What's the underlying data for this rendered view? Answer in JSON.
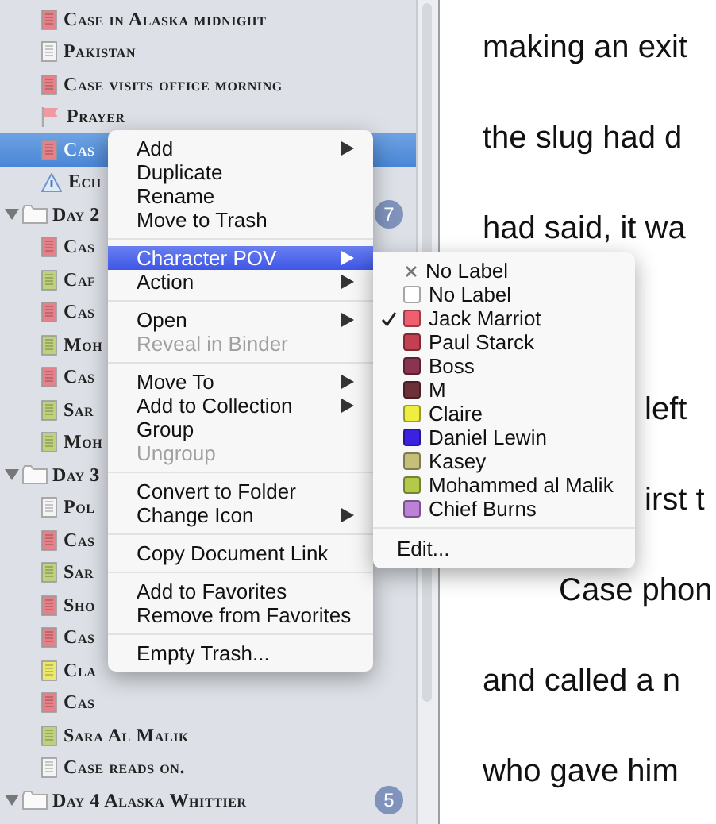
{
  "binder": {
    "leading_children": [
      {
        "kind": "doc",
        "color": "#e8808a",
        "label": "Case in Alaska midnight",
        "selected": false
      },
      {
        "kind": "doc",
        "color": "#f4f4f4",
        "label": "Pakistan",
        "selected": false
      },
      {
        "kind": "doc",
        "color": "#e8808a",
        "label": "Case visits office morning",
        "selected": false
      },
      {
        "kind": "flag",
        "label": "Prayer",
        "selected": false
      },
      {
        "kind": "doc",
        "color": "#e8808a",
        "label": "Cas",
        "selected": true
      },
      {
        "kind": "info",
        "label": "Ech",
        "selected": false
      }
    ],
    "folders": [
      {
        "label": "Day 2",
        "expanded": true,
        "badge": "7",
        "children": [
          {
            "kind": "doc",
            "color": "#e8808a",
            "label": "Cas",
            "selected": false
          },
          {
            "kind": "doc",
            "color": "#bdd27a",
            "label": "Caf",
            "selected": false
          },
          {
            "kind": "doc",
            "color": "#e8808a",
            "label": "Cas",
            "selected": false
          },
          {
            "kind": "doc",
            "color": "#bdd27a",
            "label": "Moh",
            "selected": false
          },
          {
            "kind": "doc",
            "color": "#e8808a",
            "label": "Cas",
            "selected": false
          },
          {
            "kind": "doc",
            "color": "#bdd27a",
            "label": "Sar",
            "selected": false
          },
          {
            "kind": "doc",
            "color": "#bdd27a",
            "label": "Moh",
            "selected": false
          }
        ]
      },
      {
        "label": "Day 3",
        "expanded": true,
        "children": [
          {
            "kind": "doc",
            "color": "#f4f4f4",
            "label": "Pol",
            "selected": false
          },
          {
            "kind": "doc",
            "color": "#e8808a",
            "label": "Cas",
            "selected": false
          },
          {
            "kind": "doc",
            "color": "#bdd27a",
            "label": "Sar",
            "selected": false
          },
          {
            "kind": "doc",
            "color": "#e8808a",
            "label": "Sho",
            "selected": false
          },
          {
            "kind": "doc",
            "color": "#e8808a",
            "label": "Cas",
            "selected": false
          },
          {
            "kind": "doc",
            "color": "#ece96a",
            "label": "Cla",
            "selected": false
          },
          {
            "kind": "doc",
            "color": "#e8808a",
            "label": "Cas",
            "selected": false
          },
          {
            "kind": "doc",
            "color": "#bdd27a",
            "label": "Sara Al Malik",
            "selected": false
          },
          {
            "kind": "doc",
            "color": "#f4f4f4",
            "label": "Case reads on.",
            "selected": false
          }
        ]
      },
      {
        "label": "Day 4 Alaska Whittier",
        "expanded": true,
        "badge": "5"
      }
    ]
  },
  "editor": {
    "lines": [
      {
        "kind": "full",
        "text": "making an exit"
      },
      {
        "kind": "full",
        "text": "the slug had d"
      },
      {
        "kind": "full",
        "text": "had said, it wa"
      },
      {
        "kind": "tail",
        "text": "left"
      },
      {
        "kind": "tail",
        "text": "irst t"
      },
      {
        "kind": "indent",
        "text": "Case phon"
      },
      {
        "kind": "full",
        "text": "and called a n"
      },
      {
        "kind": "full",
        "text": "who gave him"
      }
    ]
  },
  "context_menu": {
    "sections": [
      [
        {
          "label": "Add",
          "submenu": true,
          "disabled": false,
          "selected": false
        },
        {
          "label": "Duplicate",
          "submenu": false,
          "disabled": false,
          "selected": false
        },
        {
          "label": "Rename",
          "submenu": false,
          "disabled": false,
          "selected": false
        },
        {
          "label": "Move to Trash",
          "submenu": false,
          "disabled": false,
          "selected": false
        }
      ],
      [
        {
          "label": "Character POV",
          "submenu": true,
          "disabled": false,
          "selected": true
        },
        {
          "label": "Action",
          "submenu": true,
          "disabled": false,
          "selected": false
        }
      ],
      [
        {
          "label": "Open",
          "submenu": true,
          "disabled": false,
          "selected": false
        },
        {
          "label": "Reveal in Binder",
          "submenu": false,
          "disabled": true,
          "selected": false
        }
      ],
      [
        {
          "label": "Move To",
          "submenu": true,
          "disabled": false,
          "selected": false
        },
        {
          "label": "Add to Collection",
          "submenu": true,
          "disabled": false,
          "selected": false
        },
        {
          "label": "Group",
          "submenu": false,
          "disabled": false,
          "selected": false
        },
        {
          "label": "Ungroup",
          "submenu": false,
          "disabled": true,
          "selected": false
        }
      ],
      [
        {
          "label": "Convert to Folder",
          "submenu": false,
          "disabled": false,
          "selected": false
        },
        {
          "label": "Change Icon",
          "submenu": true,
          "disabled": false,
          "selected": false
        }
      ],
      [
        {
          "label": "Copy Document Link",
          "submenu": false,
          "disabled": false,
          "selected": false
        }
      ],
      [
        {
          "label": "Add to Favorites",
          "submenu": false,
          "disabled": false,
          "selected": false
        },
        {
          "label": "Remove from Favorites",
          "submenu": false,
          "disabled": false,
          "selected": false
        }
      ],
      [
        {
          "label": "Empty Trash...",
          "submenu": false,
          "disabled": false,
          "selected": false
        }
      ]
    ]
  },
  "pov_submenu": {
    "items": [
      {
        "kind": "clear",
        "label": "No Label",
        "checked": false
      },
      {
        "kind": "label",
        "label": "No Label",
        "color": "#ffffff",
        "checked": false
      },
      {
        "kind": "label",
        "label": "Jack Marriot",
        "color": "#ee5f70",
        "checked": true
      },
      {
        "kind": "label",
        "label": "Paul Starck",
        "color": "#c2404f",
        "checked": false
      },
      {
        "kind": "label",
        "label": "Boss",
        "color": "#8a3550",
        "checked": false
      },
      {
        "kind": "label",
        "label": "M",
        "color": "#6e3038",
        "checked": false
      },
      {
        "kind": "label",
        "label": "Claire",
        "color": "#eeee40",
        "checked": false
      },
      {
        "kind": "label",
        "label": "Daniel Lewin",
        "color": "#3a22e0",
        "checked": false
      },
      {
        "kind": "label",
        "label": "Kasey",
        "color": "#c4c07a",
        "checked": false
      },
      {
        "kind": "label",
        "label": "Mohammed al Malik",
        "color": "#b4c84a",
        "checked": false
      },
      {
        "kind": "label",
        "label": "Chief Burns",
        "color": "#bd82d8",
        "checked": false
      }
    ],
    "edit_label": "Edit..."
  }
}
